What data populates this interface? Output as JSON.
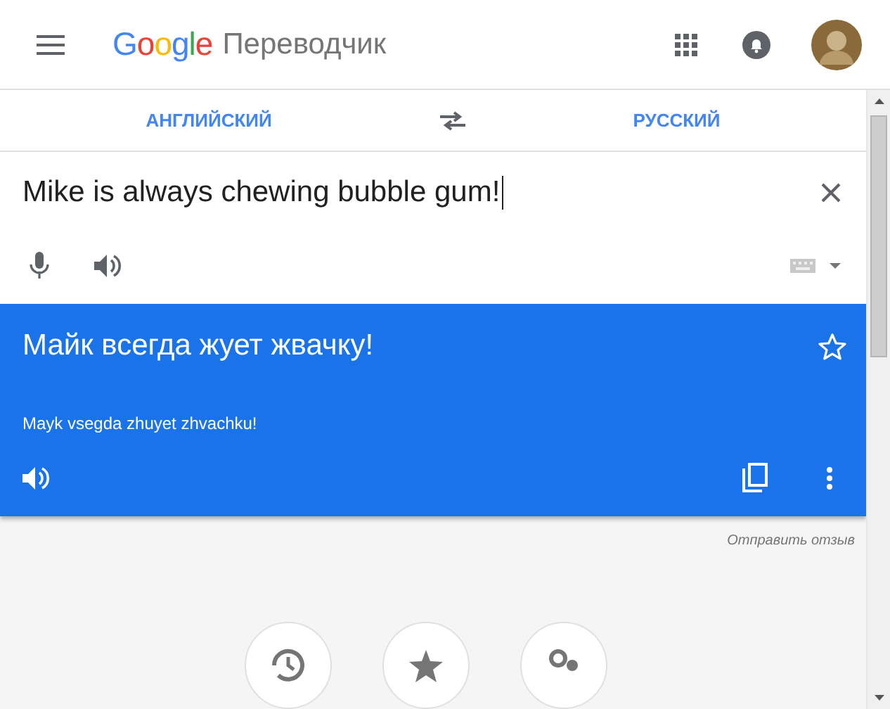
{
  "header": {
    "logo": "Google",
    "title": "Переводчик"
  },
  "languages": {
    "source": "АНГЛИЙСКИЙ",
    "target": "РУССКИЙ"
  },
  "input": {
    "value": "Mike is always chewing bubble gum!"
  },
  "translation": {
    "text": "Майк всегда жует жвачку!",
    "transliteration": "Mayk vsegda zhuyet zhvachku!",
    "starred": false
  },
  "feedback_link": "Отправить отзыв"
}
